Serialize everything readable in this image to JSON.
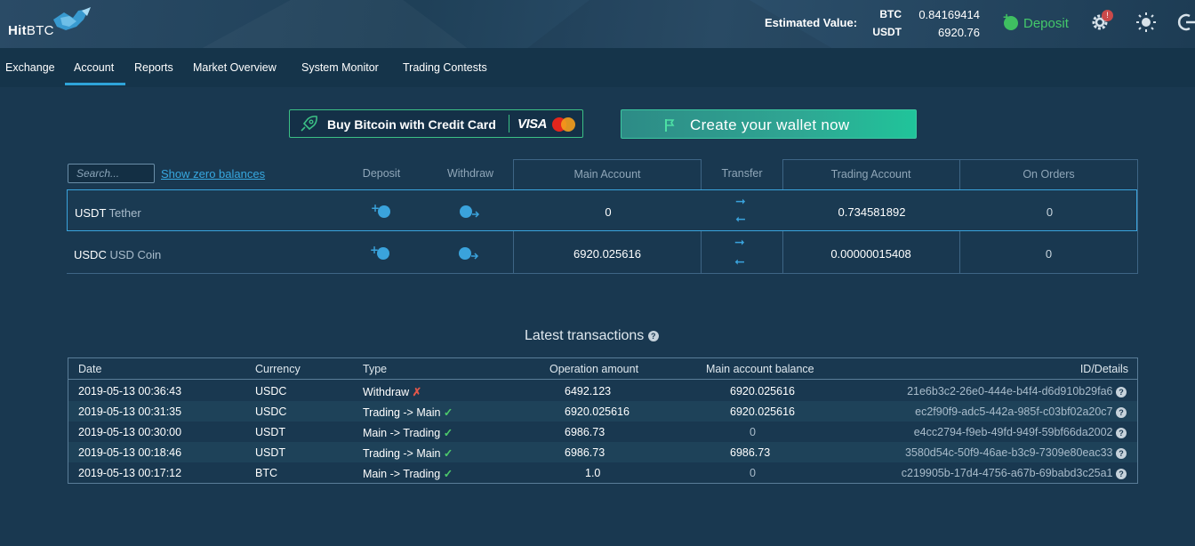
{
  "header": {
    "brand": {
      "strong": "Hit",
      "light": "BTC"
    },
    "estimated_label": "Estimated Value:",
    "btc_label": "BTC",
    "btc_value": "0.84169414",
    "usdt_label": "USDT",
    "usdt_value": "6920.76",
    "deposit_label": "Deposit",
    "badge": "!"
  },
  "nav": {
    "items": [
      "Exchange",
      "Account",
      "Reports",
      "Market Overview",
      "System Monitor",
      "Trading Contests"
    ],
    "active": "Account"
  },
  "promo": {
    "buy_label": "Buy Bitcoin with Credit Card",
    "visa_label": "VISA",
    "wallet_label": "Create your wallet now"
  },
  "balances": {
    "search_placeholder": "Search...",
    "show_zero_label": "Show zero balances",
    "columns": {
      "deposit": "Deposit",
      "withdraw": "Withdraw",
      "main": "Main Account",
      "transfer": "Transfer",
      "trading": "Trading Account",
      "orders": "On Orders"
    },
    "rows": [
      {
        "symbol": "USDT",
        "name": "Tether",
        "main": "0",
        "trading": "0.734581892",
        "orders": "0"
      },
      {
        "symbol": "USDC",
        "name": "USD Coin",
        "main": "6920.025616",
        "trading": "0.00000015408",
        "orders": "0"
      }
    ]
  },
  "transactions": {
    "title": "Latest transactions",
    "help": "?",
    "columns": {
      "date": "Date",
      "currency": "Currency",
      "type": "Type",
      "amount": "Operation amount",
      "balance": "Main account balance",
      "id": "ID/Details"
    },
    "rows": [
      {
        "date": "2019-05-13 00:36:43",
        "currency": "USDC",
        "type": "Withdraw",
        "status": "✗",
        "amount": "6492.123",
        "balance": "6920.025616",
        "id": "21e6b3c2-26e0-444e-b4f4-d6d910b29fa6"
      },
      {
        "date": "2019-05-13 00:31:35",
        "currency": "USDC",
        "type": "Trading -> Main",
        "status": "✓",
        "amount": "6920.025616",
        "balance": "6920.025616",
        "id": "ec2f90f9-adc5-442a-985f-c03bf02a20c7"
      },
      {
        "date": "2019-05-13 00:30:00",
        "currency": "USDT",
        "type": "Main -> Trading",
        "status": "✓",
        "amount": "6986.73",
        "balance": "0",
        "id": "e4cc2794-f9eb-49fd-949f-59bf66da2002"
      },
      {
        "date": "2019-05-13 00:18:46",
        "currency": "USDT",
        "type": "Trading -> Main",
        "status": "✓",
        "amount": "6986.73",
        "balance": "6986.73",
        "id": "3580d54c-50f9-46ae-b3c9-7309e80eac33"
      },
      {
        "date": "2019-05-13 00:17:12",
        "currency": "BTC",
        "type": "Main -> Trading",
        "status": "✓",
        "amount": "1.0",
        "balance": "0",
        "id": "c219905b-17d4-4756-a67b-69babd3c25a1"
      }
    ]
  }
}
